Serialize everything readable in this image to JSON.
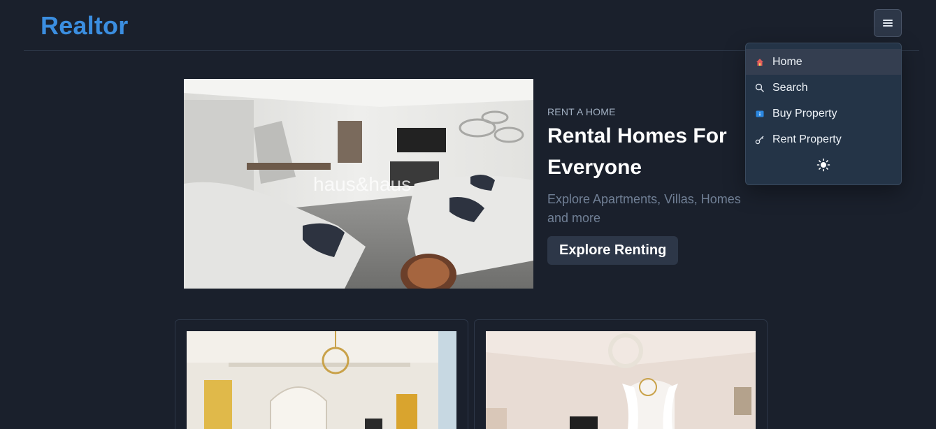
{
  "header": {
    "logo": "Realtor"
  },
  "menu": {
    "items": [
      {
        "label": "Home",
        "icon": "home-icon",
        "active": true
      },
      {
        "label": "Search",
        "icon": "search-icon",
        "active": false
      },
      {
        "label": "Buy Property",
        "icon": "info-badge-icon",
        "active": false
      },
      {
        "label": "Rent Property",
        "icon": "key-icon",
        "active": false
      }
    ],
    "theme_toggle_icon": "sun-icon"
  },
  "hero": {
    "eyebrow": "RENT A HOME",
    "title": "Rental Homes For Everyone",
    "subtitle": "Explore Apartments, Villas, Homes and more",
    "cta_label": "Explore Renting",
    "image_watermark": "haus&haus"
  },
  "colors": {
    "background": "#1a202c",
    "brand": "#3b8ee0",
    "menu_bg": "#243447"
  }
}
